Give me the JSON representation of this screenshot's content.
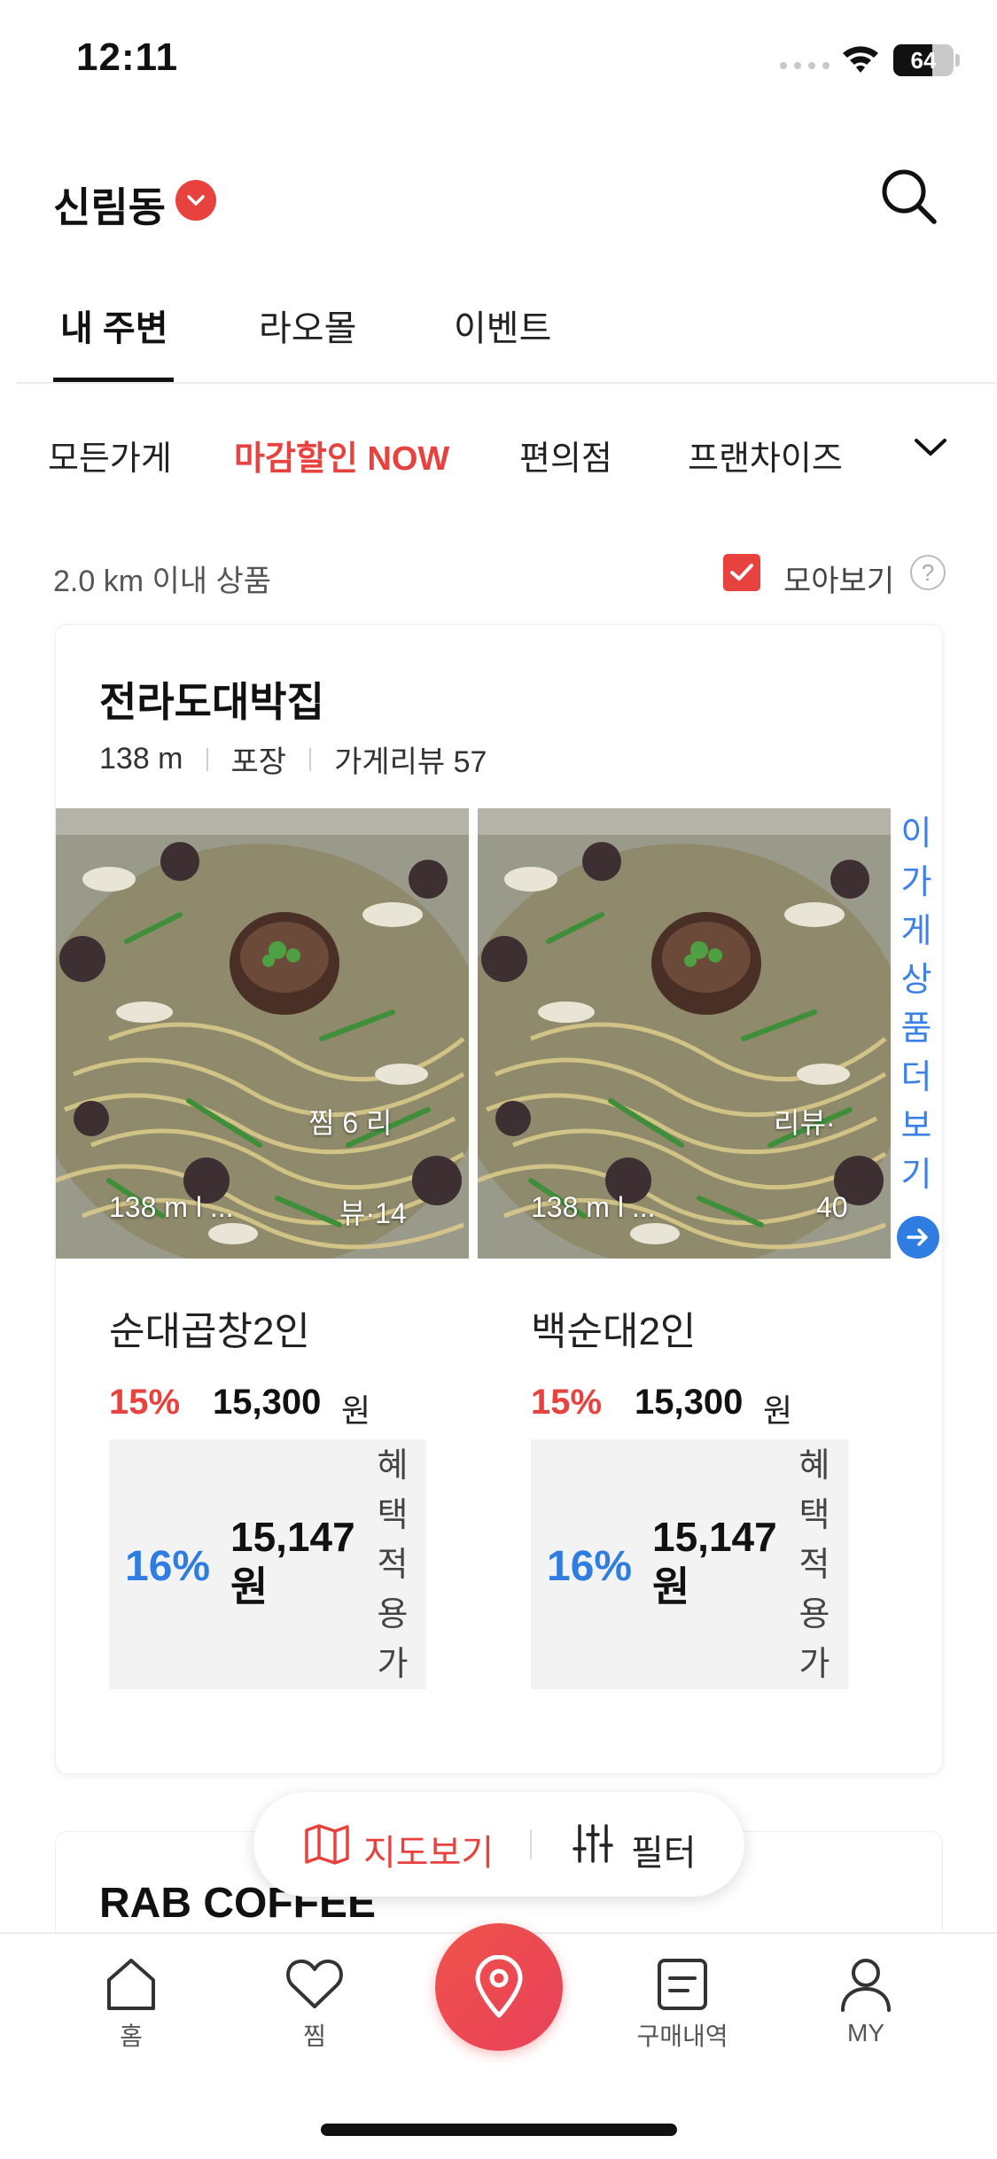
{
  "status_bar": {
    "time": "12:11",
    "battery": "64"
  },
  "header": {
    "location": "신림동"
  },
  "tabs": [
    {
      "label": "내 주변",
      "active": true
    },
    {
      "label": "라오몰",
      "active": false
    },
    {
      "label": "이벤트",
      "active": false
    }
  ],
  "categories": [
    {
      "label": "모든가게"
    },
    {
      "label": "마감할인 NOW",
      "highlight": true
    },
    {
      "label": "편의점"
    },
    {
      "label": "프랜차이즈"
    }
  ],
  "info_row": {
    "range_text": "2.0 km 이내 상품",
    "collect_label": "모아보기",
    "collect_checked": true,
    "help": "?"
  },
  "store": {
    "name": "전라도대박집",
    "distance": "138 m",
    "service": "포장",
    "reviews": "가게리뷰 57",
    "more_link": "이가게상품더보기",
    "products": [
      {
        "photo_overlay_top": "찜 6   리",
        "photo_overlay_bottom_left": "138 m  l  ...",
        "photo_overlay_bottom_right": "뷰·14",
        "name": "순대곱창2인",
        "discount": "15%",
        "price": "15,300",
        "unit": "원",
        "benefit_pct": "16%",
        "benefit_price_line1": "15,147",
        "benefit_price_line2": "원",
        "benefit_label": "혜택적용가"
      },
      {
        "photo_overlay_top": "리뷰·",
        "photo_overlay_bottom_left": "138 m  l  ...",
        "photo_overlay_bottom_right": "40",
        "name": "백순대2인",
        "discount": "15%",
        "price": "15,300",
        "unit": "원",
        "benefit_pct": "16%",
        "benefit_price_line1": "15,147",
        "benefit_price_line2": "원",
        "benefit_label": "혜택적용가"
      }
    ]
  },
  "store2": {
    "name": "RAB COFFEE"
  },
  "floating": {
    "map_label": "지도보기",
    "filter_label": "필터"
  },
  "bottom_nav": [
    {
      "label": "홈",
      "icon": "home-icon"
    },
    {
      "label": "찜",
      "icon": "heart-icon"
    },
    {
      "label": "",
      "icon": "location-pin-icon"
    },
    {
      "label": "구매내역",
      "icon": "receipt-icon"
    },
    {
      "label": "MY",
      "icon": "user-icon"
    }
  ],
  "colors": {
    "accent": "#e8423f",
    "blue": "#2f7de1"
  }
}
